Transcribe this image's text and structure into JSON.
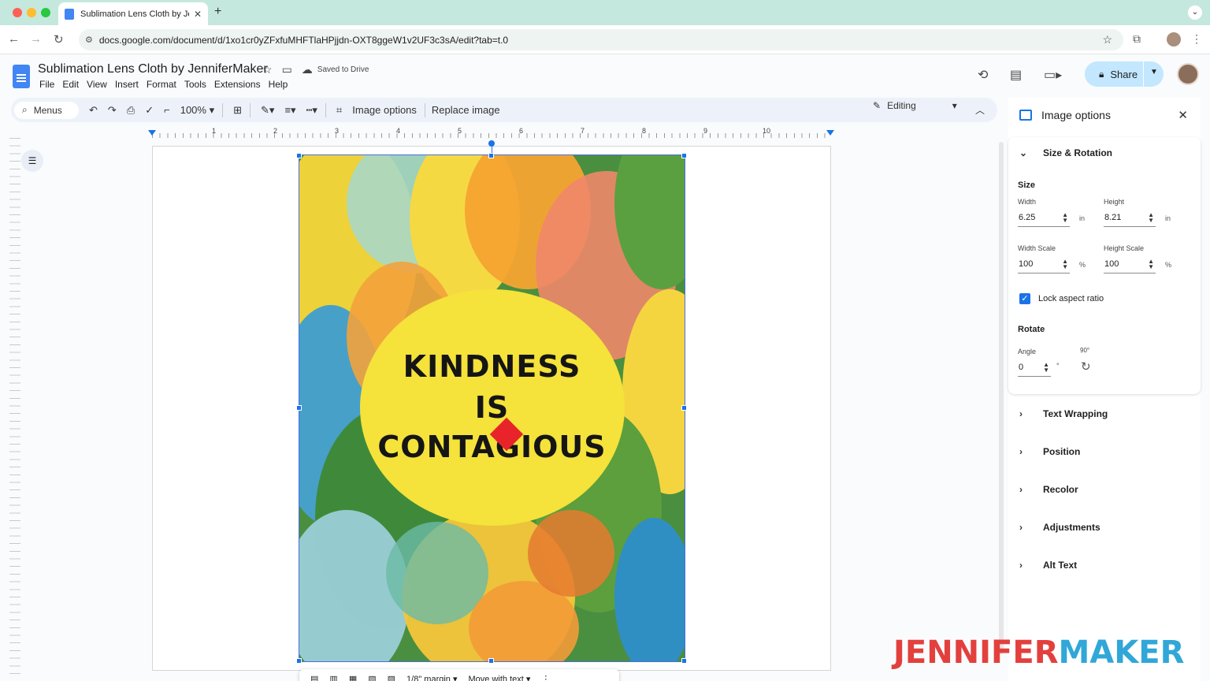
{
  "browser": {
    "tab_title": "Sublimation Lens Cloth by Jen",
    "url": "docs.google.com/document/d/1xo1cr0yZFxfuMHFTlaHPjjdn-OXT8ggeW1v2UF3c3sA/edit?tab=t.0",
    "new_tab": "+",
    "close": "✕"
  },
  "doc": {
    "title": "Sublimation Lens Cloth by JenniferMaker",
    "saved_status": "Saved to Drive",
    "menus": [
      "File",
      "Edit",
      "View",
      "Insert",
      "Format",
      "Tools",
      "Extensions",
      "Help"
    ],
    "share_label": "Share"
  },
  "toolbar": {
    "menus_label": "Menus",
    "zoom": "100%",
    "image_options": "Image options",
    "replace_image": "Replace image",
    "mode": "Editing"
  },
  "ruler": {
    "numbers": [
      "1",
      "2",
      "3",
      "4",
      "5",
      "6",
      "7",
      "8",
      "9",
      "10"
    ]
  },
  "image": {
    "line1": "KINDNESS",
    "line2": "IS",
    "line3": "CONTAGIOUS"
  },
  "image_toolbar": {
    "margin": "1/8\" margin",
    "position": "Move with text"
  },
  "panel": {
    "title": "Image options",
    "size_rotation": "Size & Rotation",
    "size_label": "Size",
    "width_label": "Width",
    "width_value": "6.25",
    "height_label": "Height",
    "height_value": "8.21",
    "unit_in": "in",
    "width_scale_label": "Width Scale",
    "width_scale_value": "100",
    "height_scale_label": "Height Scale",
    "height_scale_value": "100",
    "unit_pct": "%",
    "lock_label": "Lock aspect ratio",
    "lock_checked": true,
    "rotate_label": "Rotate",
    "angle_label": "Angle",
    "angle_value": "0",
    "angle_unit": "°",
    "rotate90_label": "90°",
    "sections": [
      "Text Wrapping",
      "Position",
      "Recolor",
      "Adjustments",
      "Alt Text"
    ]
  },
  "watermark": {
    "part1": "JENNIFER",
    "part2": "MAKER"
  },
  "colors": {
    "tabbar": "#c5e8de",
    "accent": "#1a73e8",
    "share_bg": "#c2e7ff",
    "brand_red": "#e3403d",
    "brand_blue": "#30a7d8"
  }
}
